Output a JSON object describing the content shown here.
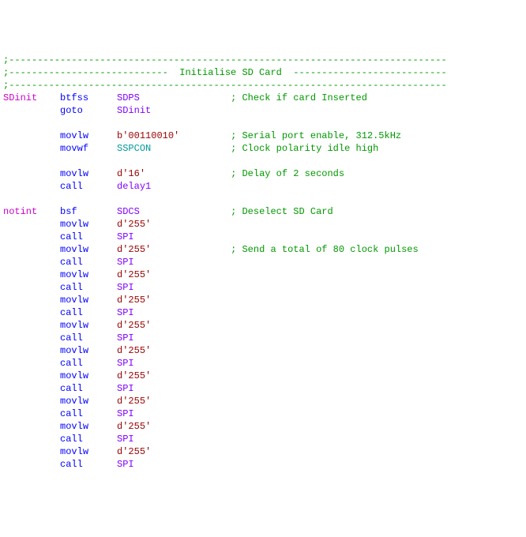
{
  "header": {
    "dashline": ";-----------------------------------------------------------------------------",
    "title": ";----------------------------  Initialise SD Card  ---------------------------"
  },
  "lines": [
    {
      "label": "SDinit",
      "opcode": "btfss",
      "operand_kind": "ident",
      "operand": "SDPS",
      "comment": "; Check if card Inserted"
    },
    {
      "label": "",
      "opcode": "goto",
      "operand_kind": "ident",
      "operand": "SDinit",
      "comment": ""
    },
    {
      "blank": true
    },
    {
      "label": "",
      "opcode": "movlw",
      "operand_kind": "lit",
      "operand": "b'00110010'",
      "comment": "; Serial port enable, 312.5kHz"
    },
    {
      "label": "",
      "opcode": "movwf",
      "operand_kind": "reg",
      "operand": "SSPCON",
      "comment": "; Clock polarity idle high"
    },
    {
      "blank": true
    },
    {
      "label": "",
      "opcode": "movlw",
      "operand_kind": "lit",
      "operand": "d'16'",
      "comment": "; Delay of 2 seconds"
    },
    {
      "label": "",
      "opcode": "call",
      "operand_kind": "ident",
      "operand": "delay1",
      "comment": ""
    },
    {
      "blank": true
    },
    {
      "label": "notint",
      "opcode": "bsf",
      "operand_kind": "ident",
      "operand": "SDCS",
      "comment": "; Deselect SD Card"
    },
    {
      "label": "",
      "opcode": "movlw",
      "operand_kind": "lit",
      "operand": "d'255'",
      "comment": ""
    },
    {
      "label": "",
      "opcode": "call",
      "operand_kind": "ident",
      "operand": "SPI",
      "comment": ""
    },
    {
      "label": "",
      "opcode": "movlw",
      "operand_kind": "lit",
      "operand": "d'255'",
      "comment": "; Send a total of 80 clock pulses"
    },
    {
      "label": "",
      "opcode": "call",
      "operand_kind": "ident",
      "operand": "SPI",
      "comment": ""
    },
    {
      "label": "",
      "opcode": "movlw",
      "operand_kind": "lit",
      "operand": "d'255'",
      "comment": ""
    },
    {
      "label": "",
      "opcode": "call",
      "operand_kind": "ident",
      "operand": "SPI",
      "comment": ""
    },
    {
      "label": "",
      "opcode": "movlw",
      "operand_kind": "lit",
      "operand": "d'255'",
      "comment": ""
    },
    {
      "label": "",
      "opcode": "call",
      "operand_kind": "ident",
      "operand": "SPI",
      "comment": ""
    },
    {
      "label": "",
      "opcode": "movlw",
      "operand_kind": "lit",
      "operand": "d'255'",
      "comment": ""
    },
    {
      "label": "",
      "opcode": "call",
      "operand_kind": "ident",
      "operand": "SPI",
      "comment": ""
    },
    {
      "label": "",
      "opcode": "movlw",
      "operand_kind": "lit",
      "operand": "d'255'",
      "comment": ""
    },
    {
      "label": "",
      "opcode": "call",
      "operand_kind": "ident",
      "operand": "SPI",
      "comment": ""
    },
    {
      "label": "",
      "opcode": "movlw",
      "operand_kind": "lit",
      "operand": "d'255'",
      "comment": ""
    },
    {
      "label": "",
      "opcode": "call",
      "operand_kind": "ident",
      "operand": "SPI",
      "comment": ""
    },
    {
      "label": "",
      "opcode": "movlw",
      "operand_kind": "lit",
      "operand": "d'255'",
      "comment": ""
    },
    {
      "label": "",
      "opcode": "call",
      "operand_kind": "ident",
      "operand": "SPI",
      "comment": ""
    },
    {
      "label": "",
      "opcode": "movlw",
      "operand_kind": "lit",
      "operand": "d'255'",
      "comment": ""
    },
    {
      "label": "",
      "opcode": "call",
      "operand_kind": "ident",
      "operand": "SPI",
      "comment": ""
    },
    {
      "label": "",
      "opcode": "movlw",
      "operand_kind": "lit",
      "operand": "d'255'",
      "comment": ""
    },
    {
      "label": "",
      "opcode": "call",
      "operand_kind": "ident",
      "operand": "SPI",
      "comment": ""
    }
  ]
}
